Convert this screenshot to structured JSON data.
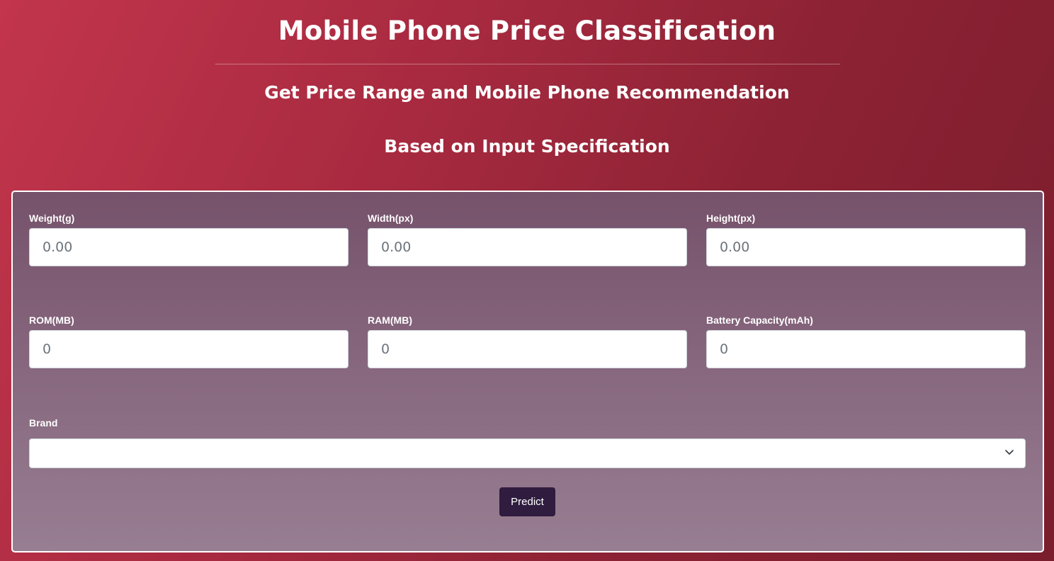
{
  "header": {
    "title": "Mobile Phone Price Classification",
    "subtitle1": "Get Price Range and Mobile Phone Recommendation",
    "subtitle2": "Based on Input Specification"
  },
  "form": {
    "fields": [
      {
        "label": "Weight(g)",
        "placeholder": "0.00"
      },
      {
        "label": "Width(px)",
        "placeholder": "0.00"
      },
      {
        "label": "Height(px)",
        "placeholder": "0.00"
      },
      {
        "label": "ROM(MB)",
        "placeholder": "0"
      },
      {
        "label": "RAM(MB)",
        "placeholder": "0"
      },
      {
        "label": "Battery Capacity(mAh)",
        "placeholder": "0"
      }
    ],
    "brand_label": "Brand",
    "brand_value": "",
    "predict_label": "Predict"
  }
}
